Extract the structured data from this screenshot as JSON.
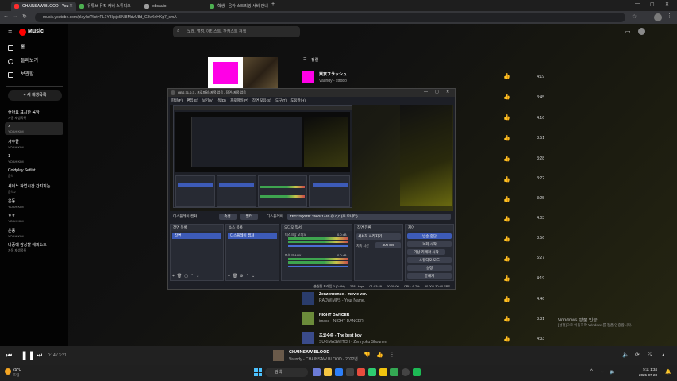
{
  "browser": {
    "tabs": [
      {
        "label": "CHAINSAW BLOOD - You",
        "color": "#ff2d2d"
      },
      {
        "label": "유튜브 뮤직 커버 스튜디오",
        "color": "#4caf50"
      },
      {
        "label": "obsauio",
        "color": "#9e9e9e"
      },
      {
        "label": "학생 - 음악 스트리밍 서비 안내",
        "color": "#4caf50"
      }
    ],
    "url": "music.youtube.com/playlist?list=PL1Y8kpjpSNi8MdvU8d_G8vXnHKg7_smA"
  },
  "ytmusic": {
    "logo": "Music",
    "search_placeholder": "노래, 앨범, 아티스트, 팟캐스트 검색",
    "nav": [
      {
        "label": "홈",
        "icon": "home-icon"
      },
      {
        "label": "둘러보기",
        "icon": "explore-icon"
      },
      {
        "label": "보관함",
        "icon": "library-icon"
      }
    ],
    "new_playlist": "+ 새 재생목록",
    "playlists": [
      {
        "name": "좋아요 표시한 음악",
        "sub": "자동 재생목록"
      },
      {
        "name": "♪",
        "sub": "YOAH KIM"
      },
      {
        "name": "가수끝",
        "sub": "YOAH KIM"
      },
      {
        "name": "1",
        "sub": "YOAH KIM"
      },
      {
        "name": "Coldplay Setlist",
        "sub": "음악"
      },
      {
        "name": "세이노 작업시간 간지피는...",
        "sub": "음악2"
      },
      {
        "name": "운동",
        "sub": "YOAH KIM"
      },
      {
        "name": "ㅎㅎ",
        "sub": "YOAH KIM"
      },
      {
        "name": "운동",
        "sub": "YOAH KIM"
      },
      {
        "name": "나중에 감상할 에피소드",
        "sub": "자동 재생목록"
      }
    ],
    "queue_header": "정렬",
    "songs_top": [
      {
        "title": "東京フラッシュ",
        "artist": "Vaundy - strobo"
      }
    ],
    "songs_bottom": [
      {
        "title": "Zenzenzense - movie ver.",
        "artist": "RADWIMPS - Your Name."
      },
      {
        "title": "NIGHT DANCER",
        "artist": "imase - NIGHT DANCER"
      },
      {
        "title": "초코수족 - The best boy",
        "artist": "SUKIMASWITCH - Zenryoku Shounen"
      }
    ],
    "durations": [
      "4:19",
      "3:45",
      "4:16",
      "3:51",
      "3:28",
      "3:22",
      "3:25",
      "4:03",
      "3:56",
      "5:27",
      "4:19",
      "4:46",
      "3:31",
      "4:33"
    ],
    "player": {
      "time": "0:14 / 3:21",
      "title": "CHAINSAW BLOOD",
      "subtitle": "Vaundy - CHAINSAW BLOOD - 2022년",
      "progress": 0.07
    }
  },
  "obs": {
    "title": "OBS 31.0.3 - 프로파일: 제목 없음 - 장면: 제목 없음",
    "menu": [
      "파일(F)",
      "편집(E)",
      "보기(V)",
      "독(D)",
      "프로파일(P)",
      "장면 모음(S)",
      "도구(T)",
      "도움말(H)"
    ],
    "source_bar": {
      "source_label": "디스플레이 캡쳐",
      "props": "속성",
      "filters": "필터",
      "display_label": "디스플레이",
      "display_value": "TFG32Q07P: 2560x1440 @ 0,0 (주 모니터)"
    },
    "docks": {
      "scenes": {
        "header": "장면 목록",
        "item": "장면"
      },
      "sources": {
        "header": "소스 목록",
        "item": "디스플레이 캡쳐"
      },
      "mixer": {
        "header": "오디오 믹서",
        "ch1": "데스크탑 오디오",
        "ch1_db": "0.0 dB",
        "ch2": "마이크/AUX",
        "ch2_db": "0.0 dB"
      },
      "transitions": {
        "header": "장면 전환",
        "type": "서서히 사라지기",
        "duration_label": "지속 시간",
        "duration": "300 ms"
      },
      "controls": {
        "header": "제어",
        "buttons": [
          "방송 중단",
          "녹화 시작",
          "가상 카메라 시작",
          "스튜디오 모드",
          "설정",
          "끝내기"
        ]
      }
    },
    "status": {
      "dropped": "손실된 프레임 0 (0.0%)",
      "bitrate": "2781 kbps",
      "stream_time": "01:03:49",
      "rec_time": "00:00:00",
      "cpu": "CPU: 6.7%",
      "fps": "30.00 / 30.00 FPS"
    }
  },
  "taskbar": {
    "weather_temp": "29°C",
    "weather_desc": "흐림",
    "search": "검색",
    "time": "오후 1:34",
    "date": "2025-07-23"
  },
  "windows_watermark": {
    "title": "Windows 정품 인증",
    "desc": "[설정]으로 이동하여 Windows를 정품 인증합니다."
  }
}
